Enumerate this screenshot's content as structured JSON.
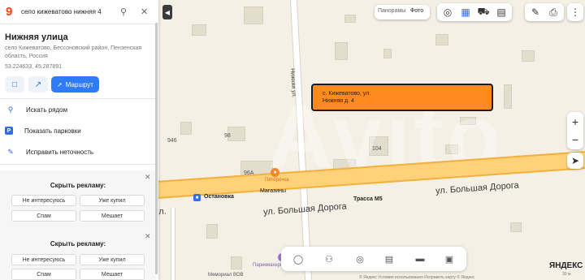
{
  "search": {
    "query": "село кижеватово нижняя 4"
  },
  "place": {
    "title": "Нижняя улица",
    "address": "село Кижеватово, Бессоновский район, Пензенская область, Россия",
    "coords": "53.224633, 45.287891",
    "route_label": "Маршрут"
  },
  "actions": [
    {
      "label": "Искать рядом"
    },
    {
      "label": "Показать парковки"
    },
    {
      "label": "Исправить неточность"
    }
  ],
  "ads": [
    {
      "heading": "Скрыть рекламу:",
      "buttons": [
        "Не интересуюсь",
        "Уже купил",
        "Спам",
        "Мешает"
      ]
    },
    {
      "heading": "Скрыть рекламу:",
      "buttons": [
        "Не интересуюсь",
        "Уже купил",
        "Спам",
        "Мешает"
      ]
    }
  ],
  "map": {
    "toggle_panoramas": "Панорамы",
    "toggle_photo": "Фото",
    "callout_line1": "с. Кижеватово, ул.",
    "callout_line2": "Нижняя д. 4",
    "street_main_1": "ул. Большая Дорога",
    "street_main_2": "ул. Большая Дорога",
    "street_vert": "Нижняя ул.",
    "highway": "Трасса М5",
    "stop_label": "Остановка",
    "shop_label": "Магазины",
    "brand_label": "Пятёрочка",
    "parking_label": "Парикмахерская",
    "memorial_label": "Мемориал ВОВ",
    "house_98": "98",
    "house_96a": "96А",
    "house_946": "946",
    "house_104": "104",
    "yandex": "ЯНДЕКС",
    "scale": "30 м",
    "footer": "© Яндекс  Условия использования  Исправить карту  © Яндекс"
  },
  "colors": {
    "accent": "#2f7bf5",
    "callout": "#ff8a1f",
    "logo": "#fc3f1d"
  }
}
